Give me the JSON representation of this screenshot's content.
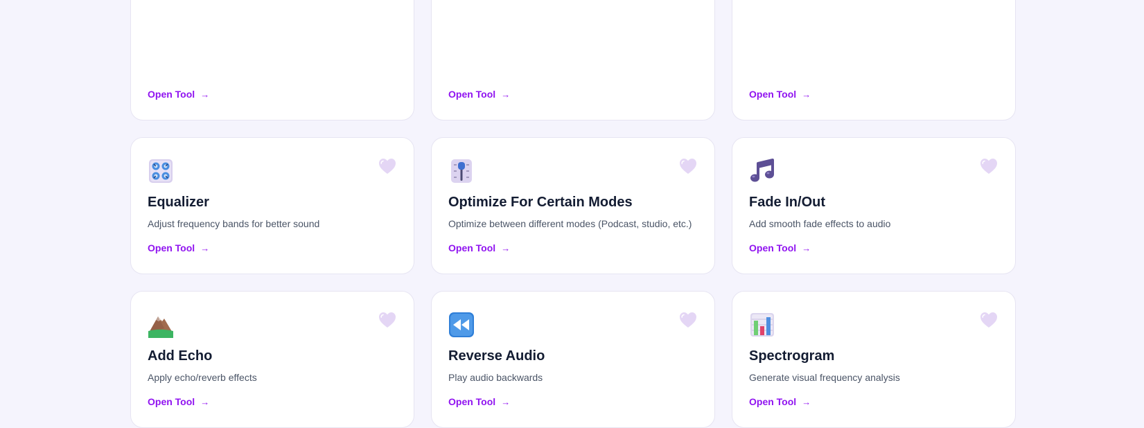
{
  "colors": {
    "page_bg": "#f5f4fd",
    "card_bg": "#ffffff",
    "title": "#131c32",
    "description": "#4a5466",
    "link_accent": "#9013f0",
    "heart": "#e4d6f5"
  },
  "tools": [
    {
      "title": "",
      "description": "",
      "link_label": "Open Tool",
      "icon": ""
    },
    {
      "title": "",
      "description": "",
      "link_label": "Open Tool",
      "icon": ""
    },
    {
      "title": "",
      "description": "",
      "link_label": "Open Tool",
      "icon": ""
    },
    {
      "title": "Equalizer",
      "description": "Adjust frequency bands for better sound",
      "link_label": "Open Tool",
      "icon": "control-knobs-icon"
    },
    {
      "title": "Optimize For Certain Modes",
      "description": "Optimize between different modes (Podcast, studio, etc.)",
      "link_label": "Open Tool",
      "icon": "level-slider-icon"
    },
    {
      "title": "Fade In/Out",
      "description": "Add smooth fade effects to audio",
      "link_label": "Open Tool",
      "icon": "musical-notes-icon"
    },
    {
      "title": "Add Echo",
      "description": "Apply echo/reverb effects",
      "link_label": "Open Tool",
      "icon": "mountain-icon"
    },
    {
      "title": "Reverse Audio",
      "description": "Play audio backwards",
      "link_label": "Open Tool",
      "icon": "rewind-button-icon"
    },
    {
      "title": "Spectrogram",
      "description": "Generate visual frequency analysis",
      "link_label": "Open Tool",
      "icon": "bar-chart-icon"
    }
  ]
}
